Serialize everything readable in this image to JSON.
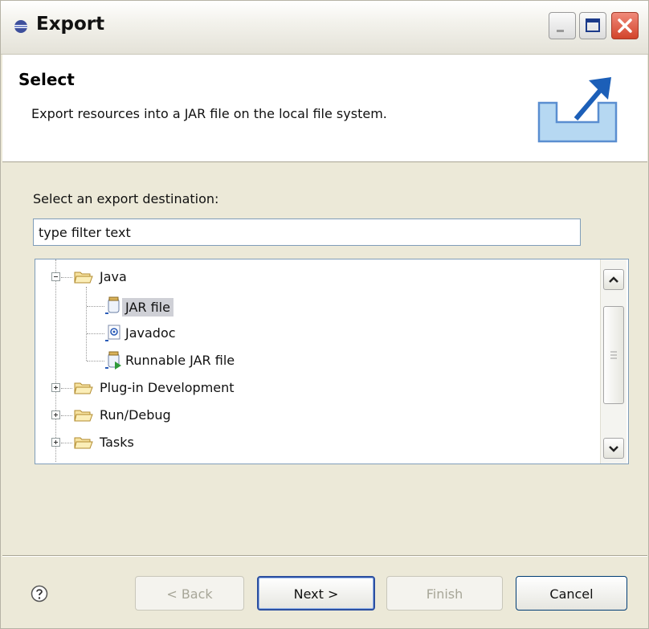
{
  "window": {
    "title": "Export",
    "title_icon": "export-icon"
  },
  "header": {
    "title": "Select",
    "description": "Export resources into a JAR file on the local file system.",
    "icon": "export-arrow-icon"
  },
  "destination": {
    "prompt": "Select an export destination:",
    "filter_value": "type filter text"
  },
  "tree": {
    "items": [
      {
        "label": "Java",
        "expanded": true,
        "icon": "folder-icon"
      },
      {
        "label": "JAR file",
        "selected": true,
        "icon": "jar-icon"
      },
      {
        "label": "Javadoc",
        "icon": "javadoc-icon"
      },
      {
        "label": "Runnable JAR file",
        "icon": "runnable-jar-icon"
      },
      {
        "label": "Plug-in Development",
        "expanded": false,
        "icon": "folder-icon"
      },
      {
        "label": "Run/Debug",
        "expanded": false,
        "icon": "folder-icon"
      },
      {
        "label": "Tasks",
        "expanded": false,
        "icon": "folder-icon"
      }
    ]
  },
  "footer": {
    "back": "< Back",
    "next": "Next >",
    "finish": "Finish",
    "cancel": "Cancel"
  },
  "colors": {
    "accent": "#2c4fa0",
    "selection": "#cfd0d6",
    "dialog_bg": "#ece9d8"
  }
}
